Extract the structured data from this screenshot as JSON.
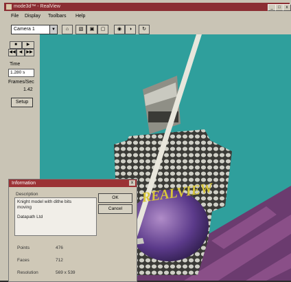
{
  "window": {
    "title": "mode3d™ - RealView",
    "min_glyph": "_",
    "max_glyph": "□",
    "close_glyph": "x"
  },
  "menu": [
    "File",
    "Display",
    "Toolbars",
    "Help"
  ],
  "toolbar": {
    "camera_value": "Camera 1",
    "dropdown_glyph": "▼",
    "buttons": [
      "⌂",
      "▧",
      "▣",
      "▢",
      "◉",
      "◑",
      "↻"
    ]
  },
  "left_panel": {
    "play_buttons": [
      "■",
      "▶",
      "◀◀",
      "◀",
      "▶▶"
    ],
    "time_label": "Time",
    "time_value": "1.280 s",
    "fps_label": "Frames/Sec",
    "fps_value": "1.42",
    "setup_label": "Setup"
  },
  "scene": {
    "shield_text": "REALVIEW",
    "sky_color": "#2f9f9c",
    "floor_colors": [
      "#6b3b6f",
      "#8a4f88"
    ]
  },
  "dialog": {
    "title": "Information",
    "close_glyph": "x",
    "description_label": "Description",
    "description_lines": [
      "Knight model with dithe bits",
      "moving",
      "Datapath Ltd"
    ],
    "ok_label": "OK",
    "cancel_label": "Cancel",
    "stats": [
      {
        "label": "Points",
        "value": "476"
      },
      {
        "label": "Faces",
        "value": "712"
      },
      {
        "label": "Resolution",
        "value": "569 x 539"
      }
    ]
  }
}
